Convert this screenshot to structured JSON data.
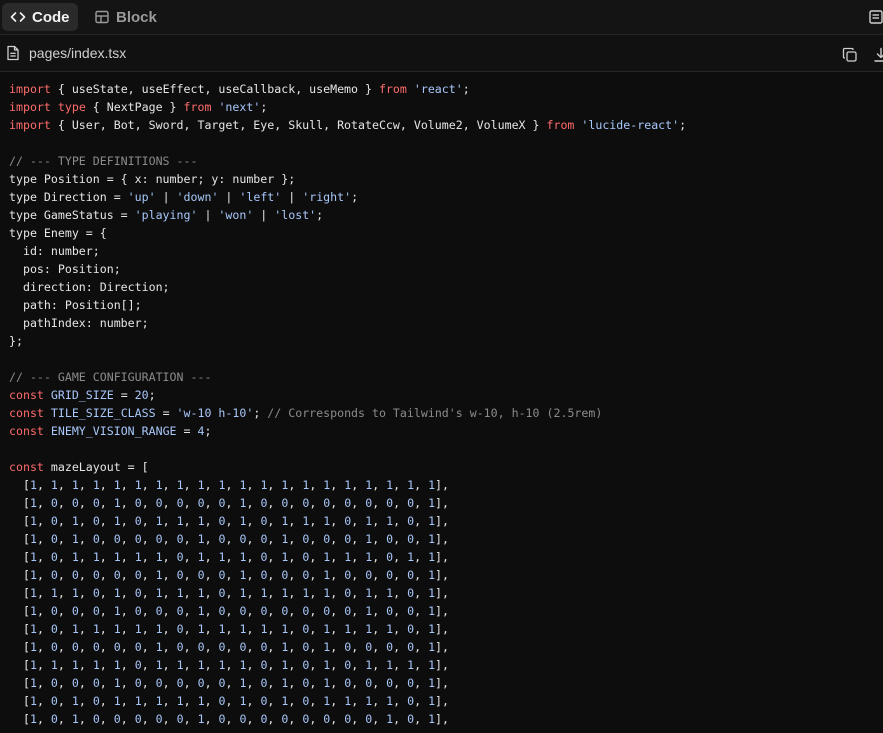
{
  "tabs": {
    "code_label": "Code",
    "block_label": "Block"
  },
  "file": {
    "name": "pages/index.tsx"
  },
  "colors": {
    "keyword": "#ff6b6b",
    "string": "#a8c7fa",
    "comment": "#8b8b8b",
    "plain": "#e6e6e6",
    "background": "#0d0d0d"
  },
  "code_lines": [
    [
      [
        "kw",
        "import"
      ],
      [
        "pl",
        " { useState, useEffect, useCallback, useMemo } "
      ],
      [
        "kw",
        "from"
      ],
      [
        "pl",
        " "
      ],
      [
        "str",
        "'react'"
      ],
      [
        "pl",
        ";"
      ]
    ],
    [
      [
        "kw",
        "import"
      ],
      [
        "pl",
        " "
      ],
      [
        "kw",
        "type"
      ],
      [
        "pl",
        " { NextPage } "
      ],
      [
        "kw",
        "from"
      ],
      [
        "pl",
        " "
      ],
      [
        "str",
        "'next'"
      ],
      [
        "pl",
        ";"
      ]
    ],
    [
      [
        "kw",
        "import"
      ],
      [
        "pl",
        " { User, Bot, Sword, Target, Eye, Skull, RotateCcw, Volume2, VolumeX } "
      ],
      [
        "kw",
        "from"
      ],
      [
        "pl",
        " "
      ],
      [
        "str",
        "'lucide-react'"
      ],
      [
        "pl",
        ";"
      ]
    ],
    [],
    [
      [
        "cm",
        "// --- TYPE DEFINITIONS ---"
      ]
    ],
    [
      [
        "pl",
        "type Position = { x: number; y: number };"
      ]
    ],
    [
      [
        "pl",
        "type Direction = "
      ],
      [
        "str",
        "'up'"
      ],
      [
        "pl",
        " | "
      ],
      [
        "str",
        "'down'"
      ],
      [
        "pl",
        " | "
      ],
      [
        "str",
        "'left'"
      ],
      [
        "pl",
        " | "
      ],
      [
        "str",
        "'right'"
      ],
      [
        "pl",
        ";"
      ]
    ],
    [
      [
        "pl",
        "type GameStatus = "
      ],
      [
        "str",
        "'playing'"
      ],
      [
        "pl",
        " | "
      ],
      [
        "str",
        "'won'"
      ],
      [
        "pl",
        " | "
      ],
      [
        "str",
        "'lost'"
      ],
      [
        "pl",
        ";"
      ]
    ],
    [
      [
        "pl",
        "type Enemy = {"
      ]
    ],
    [
      [
        "pl",
        "  id: number;"
      ]
    ],
    [
      [
        "pl",
        "  pos: Position;"
      ]
    ],
    [
      [
        "pl",
        "  direction: Direction;"
      ]
    ],
    [
      [
        "pl",
        "  path: Position[];"
      ]
    ],
    [
      [
        "pl",
        "  pathIndex: number;"
      ]
    ],
    [
      [
        "pl",
        "};"
      ]
    ],
    [],
    [
      [
        "cm",
        "// --- GAME CONFIGURATION ---"
      ]
    ],
    [
      [
        "kw",
        "const"
      ],
      [
        "pl",
        " "
      ],
      [
        "str",
        "GRID_SIZE"
      ],
      [
        "pl",
        " = "
      ],
      [
        "num",
        "20"
      ],
      [
        "pl",
        ";"
      ]
    ],
    [
      [
        "kw",
        "const"
      ],
      [
        "pl",
        " "
      ],
      [
        "str",
        "TILE_SIZE_CLASS"
      ],
      [
        "pl",
        " = "
      ],
      [
        "str",
        "'w-10 h-10'"
      ],
      [
        "pl",
        "; "
      ],
      [
        "cm",
        "// Corresponds to Tailwind's w-10, h-10 (2.5rem)"
      ]
    ],
    [
      [
        "kw",
        "const"
      ],
      [
        "pl",
        " "
      ],
      [
        "str",
        "ENEMY_VISION_RANGE"
      ],
      [
        "pl",
        " = "
      ],
      [
        "num",
        "4"
      ],
      [
        "pl",
        ";"
      ]
    ],
    [],
    [
      [
        "kw",
        "const"
      ],
      [
        "pl",
        " mazeLayout = ["
      ]
    ]
  ],
  "maze_rows": [
    "1, 1, 1, 1, 1, 1, 1, 1, 1, 1, 1, 1, 1, 1, 1, 1, 1, 1, 1, 1",
    "1, 0, 0, 0, 1, 0, 0, 0, 0, 0, 1, 0, 0, 0, 0, 0, 0, 0, 0, 1",
    "1, 0, 1, 0, 1, 0, 1, 1, 1, 0, 1, 0, 1, 1, 1, 0, 1, 1, 0, 1",
    "1, 0, 1, 0, 0, 0, 0, 0, 1, 0, 0, 0, 1, 0, 0, 0, 1, 0, 0, 1",
    "1, 0, 1, 1, 1, 1, 1, 0, 1, 1, 1, 0, 1, 0, 1, 1, 1, 0, 1, 1",
    "1, 0, 0, 0, 0, 0, 1, 0, 0, 0, 1, 0, 0, 0, 1, 0, 0, 0, 0, 1",
    "1, 1, 1, 0, 1, 0, 1, 1, 1, 0, 1, 1, 1, 1, 1, 0, 1, 1, 0, 1",
    "1, 0, 0, 0, 1, 0, 0, 0, 1, 0, 0, 0, 0, 0, 0, 0, 1, 0, 0, 1",
    "1, 0, 1, 1, 1, 1, 1, 0, 1, 1, 1, 1, 1, 0, 1, 1, 1, 1, 0, 1",
    "1, 0, 0, 0, 0, 0, 1, 0, 0, 0, 0, 0, 1, 0, 1, 0, 0, 0, 0, 1",
    "1, 1, 1, 1, 1, 0, 1, 1, 1, 1, 1, 0, 1, 0, 1, 0, 1, 1, 1, 1",
    "1, 0, 0, 0, 1, 0, 0, 0, 0, 0, 1, 0, 1, 0, 1, 0, 0, 0, 0, 1",
    "1, 0, 1, 0, 1, 1, 1, 1, 1, 0, 1, 0, 1, 0, 1, 1, 1, 1, 0, 1",
    "1, 0, 1, 0, 0, 0, 0, 0, 1, 0, 0, 0, 0, 0, 0, 0, 0, 1, 0, 1"
  ]
}
